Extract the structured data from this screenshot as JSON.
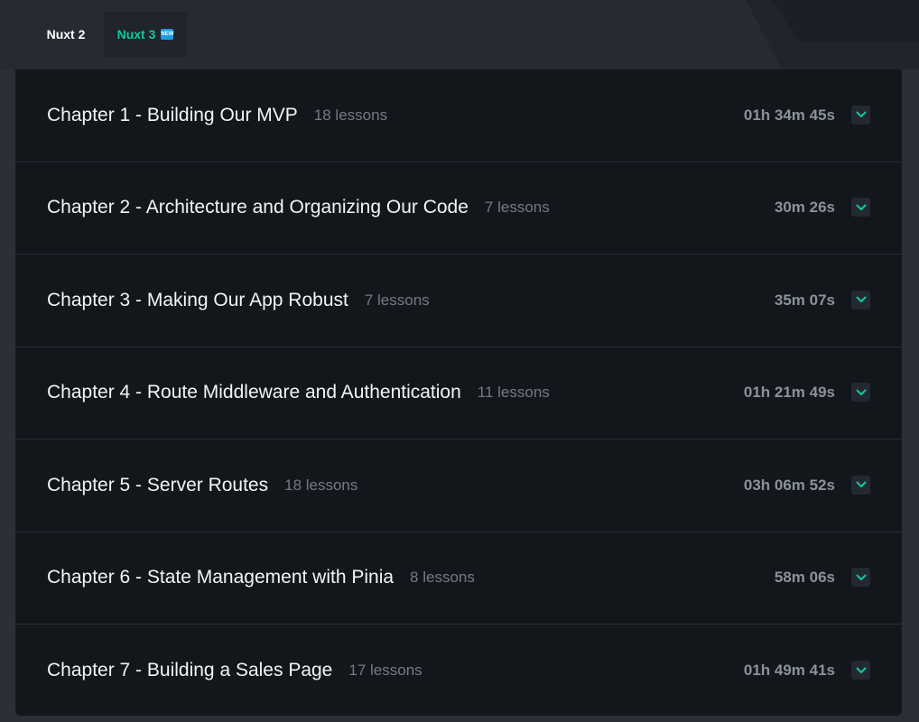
{
  "tabs": {
    "nuxt2_label": "Nuxt 2",
    "nuxt3_label": "Nuxt 3",
    "nuxt3_badge": "NEW"
  },
  "colors": {
    "accent": "#12c99b",
    "badge": "#1e9be0",
    "panel_bg": "#13161b",
    "page_bg": "#2a2f38"
  },
  "chapters": [
    {
      "title": "Chapter 1 - Building Our MVP",
      "lessons": "18 lessons",
      "duration": "01h 34m 45s",
      "icon": "chevron-down-icon"
    },
    {
      "title": "Chapter 2 - Architecture and Organizing Our Code",
      "lessons": "7 lessons",
      "duration": "30m 26s",
      "icon": "chevron-down-icon"
    },
    {
      "title": "Chapter 3 - Making Our App Robust",
      "lessons": "7 lessons",
      "duration": "35m 07s",
      "icon": "chevron-down-icon"
    },
    {
      "title": "Chapter 4 - Route Middleware and Authentication",
      "lessons": "11 lessons",
      "duration": "01h 21m 49s",
      "icon": "chevron-down-icon"
    },
    {
      "title": "Chapter 5 - Server Routes",
      "lessons": "18 lessons",
      "duration": "03h 06m 52s",
      "icon": "chevron-down-icon"
    },
    {
      "title": "Chapter 6 - State Management with Pinia",
      "lessons": "8 lessons",
      "duration": "58m 06s",
      "icon": "chevron-down-icon"
    },
    {
      "title": "Chapter 7 - Building a Sales Page",
      "lessons": "17 lessons",
      "duration": "01h 49m 41s",
      "icon": "chevron-down-icon"
    }
  ]
}
